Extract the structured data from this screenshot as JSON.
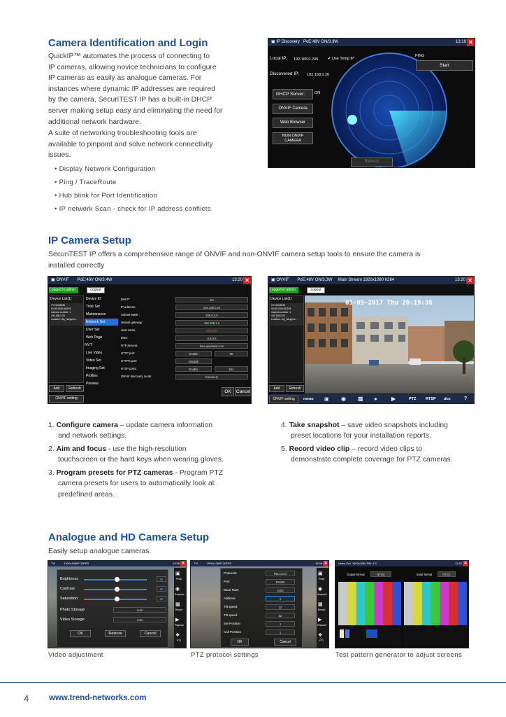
{
  "section1": {
    "title": "Camera Identification and Login",
    "para1": [
      "QuickIP™ automates the process of connecting to",
      "IP cameras, allowing novice technicians to configure",
      "IP cameras as easily as analogue cameras. For",
      "instances where dynamic IP addresses are required",
      "by the camera, SecuriTEST IP has a built-in DHCP",
      "server making setup easy and eliminating the need for",
      "additional network hardware."
    ],
    "para2": [
      "A suite of networking troubleshooting tools are",
      "available to pinpoint and solve network connectivity",
      "issues."
    ],
    "bullets": [
      "• Display Network Configuration",
      "• Ping / TraceRoute",
      "• Hub blink for Port Identification",
      "• IP network Scan - check for IP address conflicts"
    ]
  },
  "ipdiscovery": {
    "title": "IP Discovery",
    "poe": "PoE:48V ON/3.3W",
    "time": "13:19",
    "local_ip_label": "Local IP:",
    "local_ip": "192.168.0.245",
    "use_temp": "Use Temp IP",
    "discovered_label": "Discovered IP:",
    "discovered_ip": "192.168.0.20",
    "ping_label": "PING",
    "start": "Start",
    "dhcp": "DHCP Server:",
    "dhcp_val": "ON",
    "onvif": "ONVIF Camera",
    "browser": "Web Browser",
    "non_onvif": [
      "NON ONVIF",
      "CAMERA"
    ],
    "refresh": "Refresh"
  },
  "section2": {
    "title": "IP Camera Setup",
    "para": [
      "SecuriTEST IP offers a comprehensive range of ONVIF and non-ONVIF camera setup tools to ensure the camera is",
      "installed correctly"
    ]
  },
  "onvif1": {
    "title": "ONVIF",
    "poe": "PoE:48V ON/3.4W",
    "time": "13:20",
    "logged": "Logged in:admin",
    "logout": "Logout",
    "device_list": "Device List(1)",
    "device_info": [
      "XY-NVU8036",
      "00:0F:2100:5D2F8",
      "Camera number: 1",
      "192.168.0.20",
      "Location: city_hangzhu..."
    ],
    "menu": [
      "Device ID",
      "Time Set",
      "Maintenance",
      "Network Set",
      "User Set",
      "Web Page",
      "NVT",
      "Live Video",
      "Video Set",
      "Imaging Set",
      "Profiles",
      "Preview"
    ],
    "fields": [
      {
        "label": "DHCP:",
        "value": "On"
      },
      {
        "label": "IP address:",
        "value": "192.168.0.20"
      },
      {
        "label": "Subnet Mask :",
        "value": "255.0.0.0"
      },
      {
        "label": "Default gateway:",
        "value": "192.168.1.1"
      },
      {
        "label": "Host name:",
        "value": "Hikvision"
      },
      {
        "label": "DNS:",
        "value": "8.8.8.8"
      },
      {
        "label": "NTP servers:",
        "value": "time.windows.com"
      },
      {
        "label": "HTTP port:",
        "value": "Enable",
        "value2": "80"
      },
      {
        "label": "HTTPS port:",
        "value": "Disable"
      },
      {
        "label": "RTSP ports:",
        "value": "Enable",
        "value2": "554"
      },
      {
        "label": "ONVIF discovery mode:",
        "value": "Discovery"
      }
    ],
    "add": "Add",
    "refresh": "Refresh",
    "setting": "ONVIF setting",
    "ok": "OK",
    "cancel": "Cancel"
  },
  "onvif2": {
    "title": "ONVIF",
    "poe": "PoE:48V ON/3.3W",
    "stream": "Main Stream 1920x1080 h264",
    "time": "13:20",
    "logged": "Logged in:admin",
    "logout": "Logout",
    "device_list": "Device List(1)",
    "device_info": [
      "XY-NVU8036",
      "00:0F:2100:5D2F8",
      "Camera number: 1",
      "192.168.0.20",
      "Location: city_hangzho..."
    ],
    "timestamp": "03-09-2017 Thu 20:19:38",
    "add": "Add",
    "refresh": "Refresh",
    "setting": "ONVIF setting",
    "toolbar": [
      "menu",
      "PTZ",
      "RTSP",
      "doc",
      "?"
    ]
  },
  "steps_left": [
    {
      "num": "1.",
      "head": "Configure camera",
      "lines": [
        " – update camera information",
        "and network settings."
      ]
    },
    {
      "num": "2.",
      "head": "Aim and focus",
      "lines": [
        " - use the high-resolution",
        "touchscreen or the hard keys when wearing gloves."
      ]
    },
    {
      "num": "3.",
      "head": "Program presets for PTZ cameras",
      "lines": [
        " - Program PTZ",
        "camera presets for users to automatically look at",
        "predefined areas."
      ]
    }
  ],
  "steps_right": [
    {
      "num": "4.",
      "head": "Take snapshot",
      "lines": [
        " – save video snapshots including",
        "preset locations for your installation reports."
      ]
    },
    {
      "num": "5.",
      "head": "Record video clip",
      "lines": [
        " – record video clips to",
        "demonstrate complete coverage for PTZ cameras."
      ]
    }
  ],
  "section3": {
    "title": "Analogue and HD Camera Setup",
    "para": "Easily setup analogue cameras."
  },
  "ana1": {
    "title": "TVI",
    "res": "1920x1080P 25FPS",
    "time": "13:38",
    "rows": [
      "Brightness",
      "Contrast",
      "Saturation"
    ],
    "row_vals": [
      "50",
      "50",
      "50"
    ],
    "photo": "Photo Storage",
    "video": "Video Storage",
    "auto": "Auto",
    "ok": "OK",
    "restore": "Restore",
    "cancel": "Cancel",
    "side": [
      "Photo",
      "Snapshot",
      "Record",
      "Playback",
      "PTZ"
    ]
  },
  "ana2": {
    "title": "TVI",
    "res": "1920x1080P 30FPS",
    "time": "13:38",
    "rows": [
      {
        "label": "Protocols",
        "value": "PELCO-D"
      },
      {
        "label": "Port:",
        "value": "RS485"
      },
      {
        "label": "Baud Rate:",
        "value": "2400"
      },
      {
        "label": "Address",
        "value": "1"
      },
      {
        "label": "Tilt speed",
        "value": "32"
      },
      {
        "label": "Tilt speed",
        "value": "32"
      },
      {
        "label": "Set Position",
        "value": "1"
      },
      {
        "label": "Call Position",
        "value": "1"
      }
    ],
    "ok": "OK",
    "cancel": "Cancel",
    "side": [
      "Photo",
      "Snapshot",
      "Record",
      "Playback",
      "PTZ"
    ]
  },
  "ana3": {
    "title": "Video Out",
    "res": "1920x1080 PAL 4:3",
    "time": "13:32",
    "out_label": "Output format",
    "out_val": "NTSC",
    "in_label": "Input format",
    "in_val": "NTSC",
    "bar_colors": [
      "#c9c9c9",
      "#d8d83a",
      "#2fc8c8",
      "#3ac83a",
      "#c83ac8",
      "#d43030",
      "#3050d4",
      "#111111"
    ]
  },
  "captions": [
    "Video adjustment",
    "PTZ protocol settings",
    "Test pattern generator to adjust screens"
  ],
  "footer": {
    "page": "4",
    "site": "www.trend-networks.com"
  },
  "colors": {
    "accent": "#1f4fa0",
    "topbar": "#1d2a48",
    "green": "#1aa11a"
  }
}
